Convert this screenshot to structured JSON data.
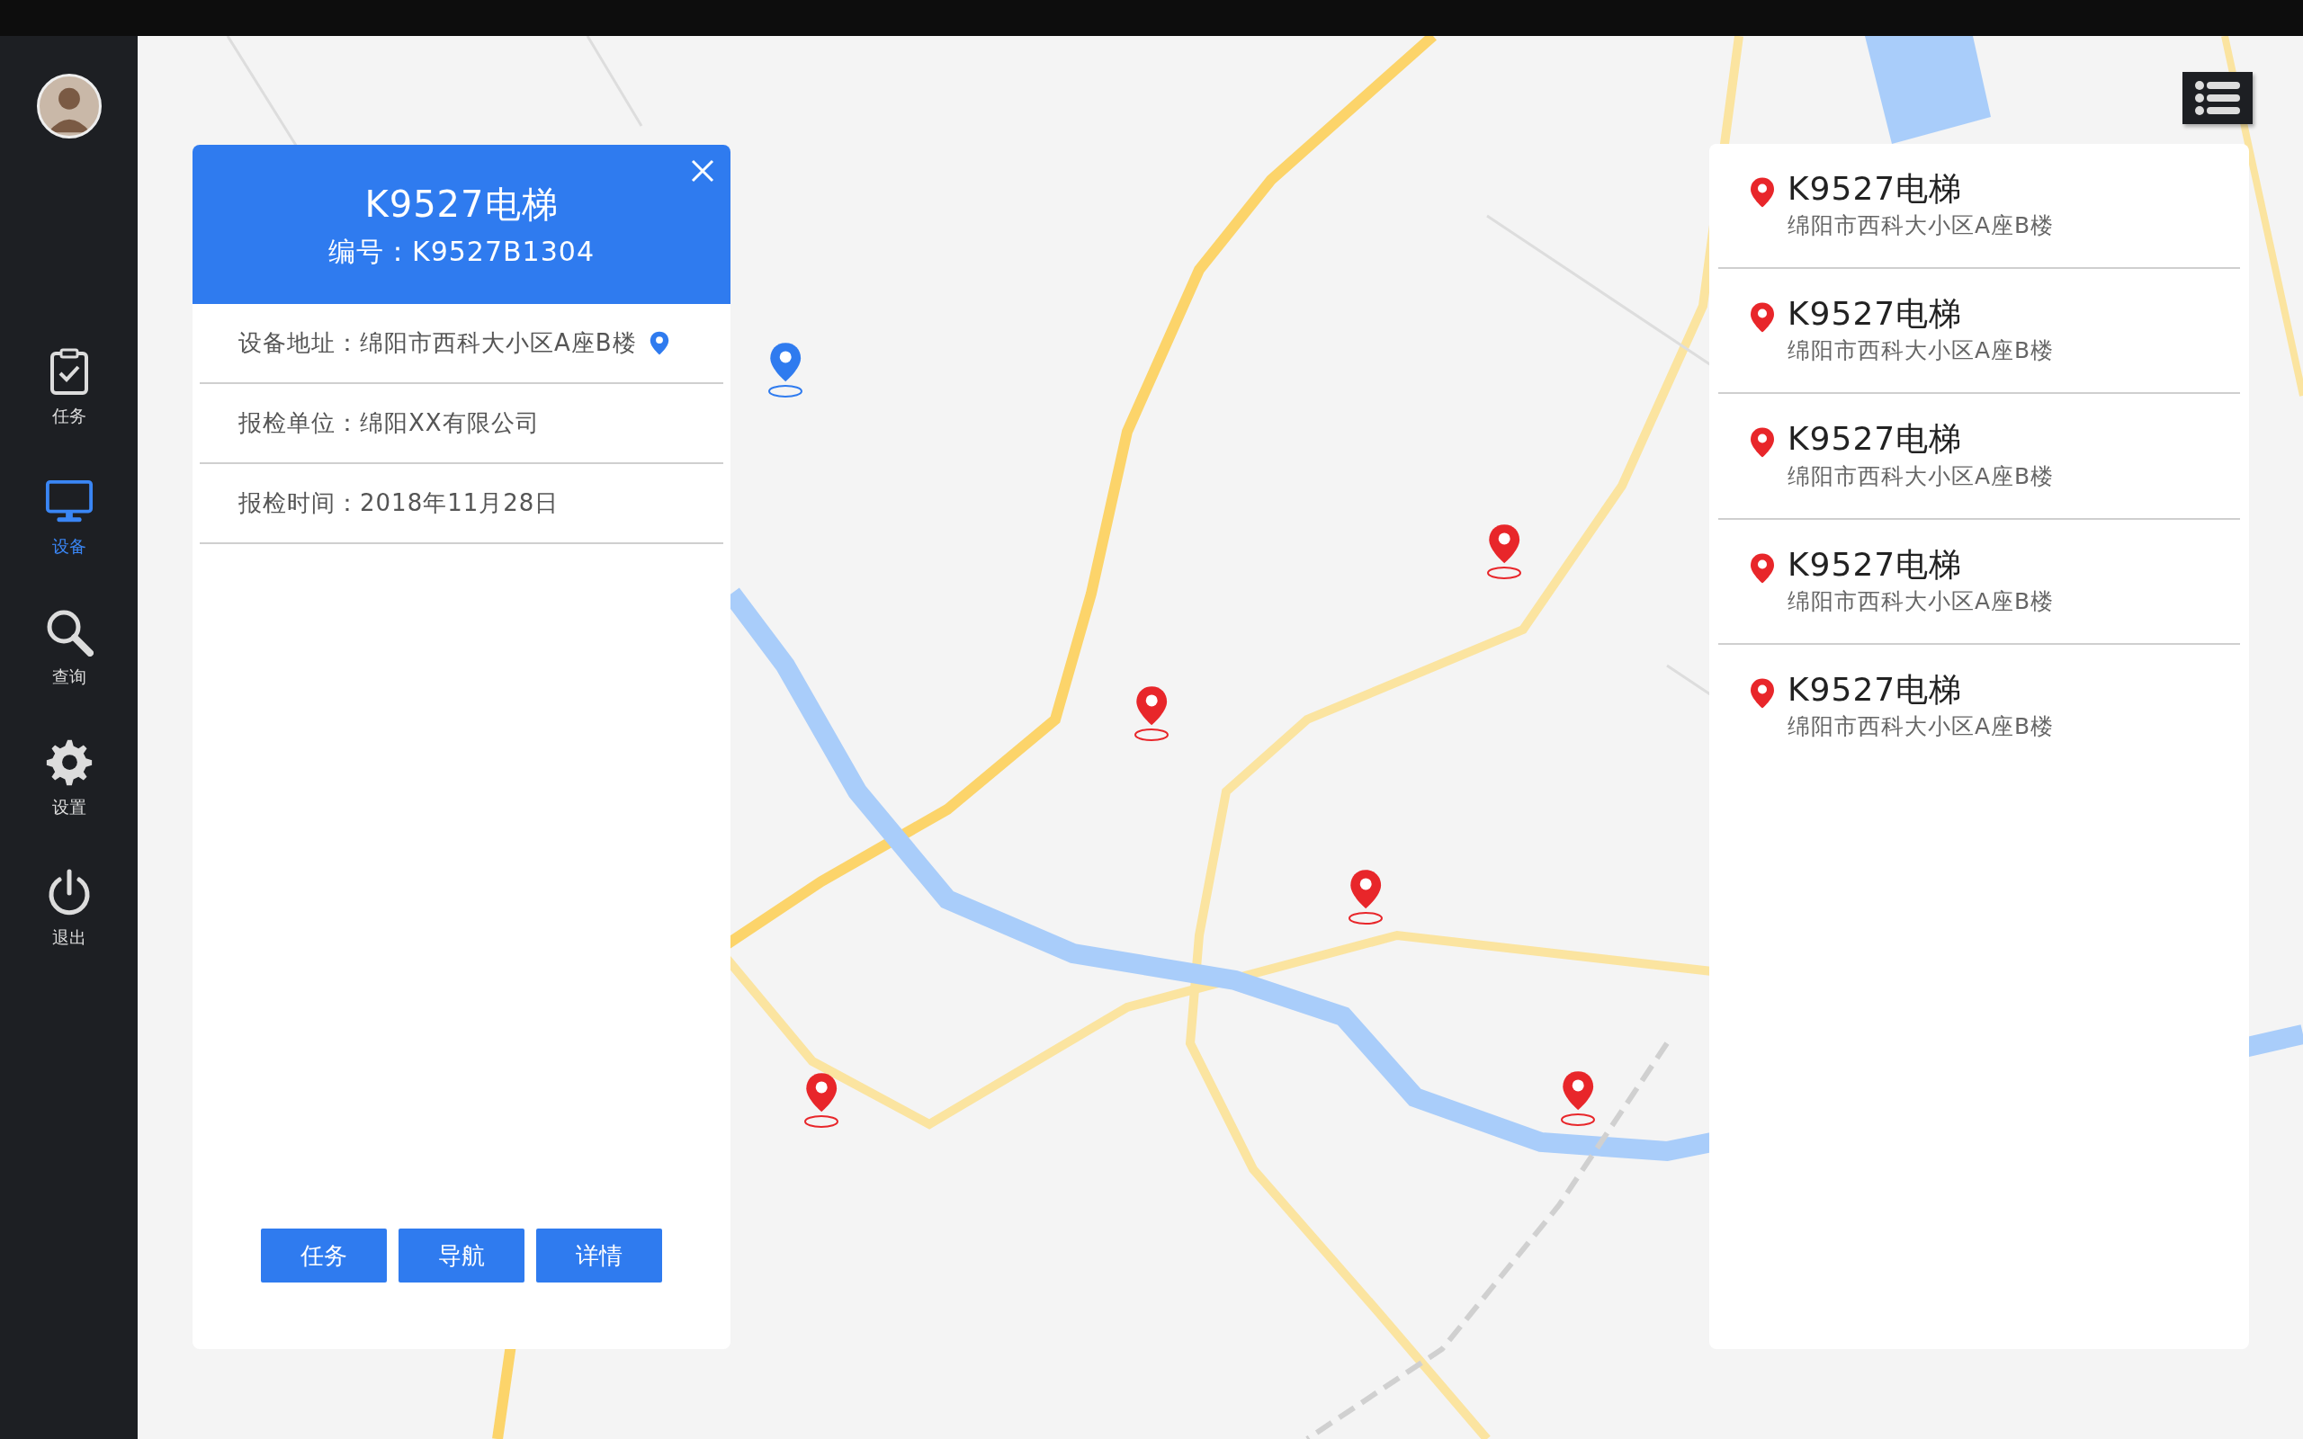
{
  "sidebar": {
    "items": [
      {
        "label": "任务",
        "kind": "task",
        "selected": false
      },
      {
        "label": "设备",
        "kind": "device",
        "selected": true
      },
      {
        "label": "查询",
        "kind": "search",
        "selected": false
      },
      {
        "label": "设置",
        "kind": "settings",
        "selected": false
      },
      {
        "label": "退出",
        "kind": "logout",
        "selected": false
      }
    ]
  },
  "popup": {
    "title": "K9527电梯",
    "code": "编号：K9527B1304",
    "fields": [
      {
        "text": "设备地址：绵阳市西科大小区A座B楼",
        "kind": "address"
      },
      {
        "text": "报检单位：绵阳XX有限公司",
        "kind": "plain"
      },
      {
        "text": "报检时间：2018年11月28日",
        "kind": "plain"
      }
    ],
    "buttons": [
      "任务",
      "导航",
      "详情"
    ]
  },
  "device_list": {
    "items": [
      {
        "title": "K9527电梯",
        "address": "绵阳市西科大小区A座B楼"
      },
      {
        "title": "K9527电梯",
        "address": "绵阳市西科大小区A座B楼"
      },
      {
        "title": "K9527电梯",
        "address": "绵阳市西科大小区A座B楼"
      },
      {
        "title": "K9527电梯",
        "address": "绵阳市西科大小区A座B楼"
      },
      {
        "title": "K9527电梯",
        "address": "绵阳市西科大小区A座B楼"
      }
    ]
  },
  "map": {
    "markers": [
      {
        "color": "#2f7bef"
      },
      {
        "color": "#e8262a"
      },
      {
        "color": "#e8262a"
      },
      {
        "color": "#e8262a"
      },
      {
        "color": "#e8262a"
      },
      {
        "color": "#e8262a"
      }
    ]
  }
}
